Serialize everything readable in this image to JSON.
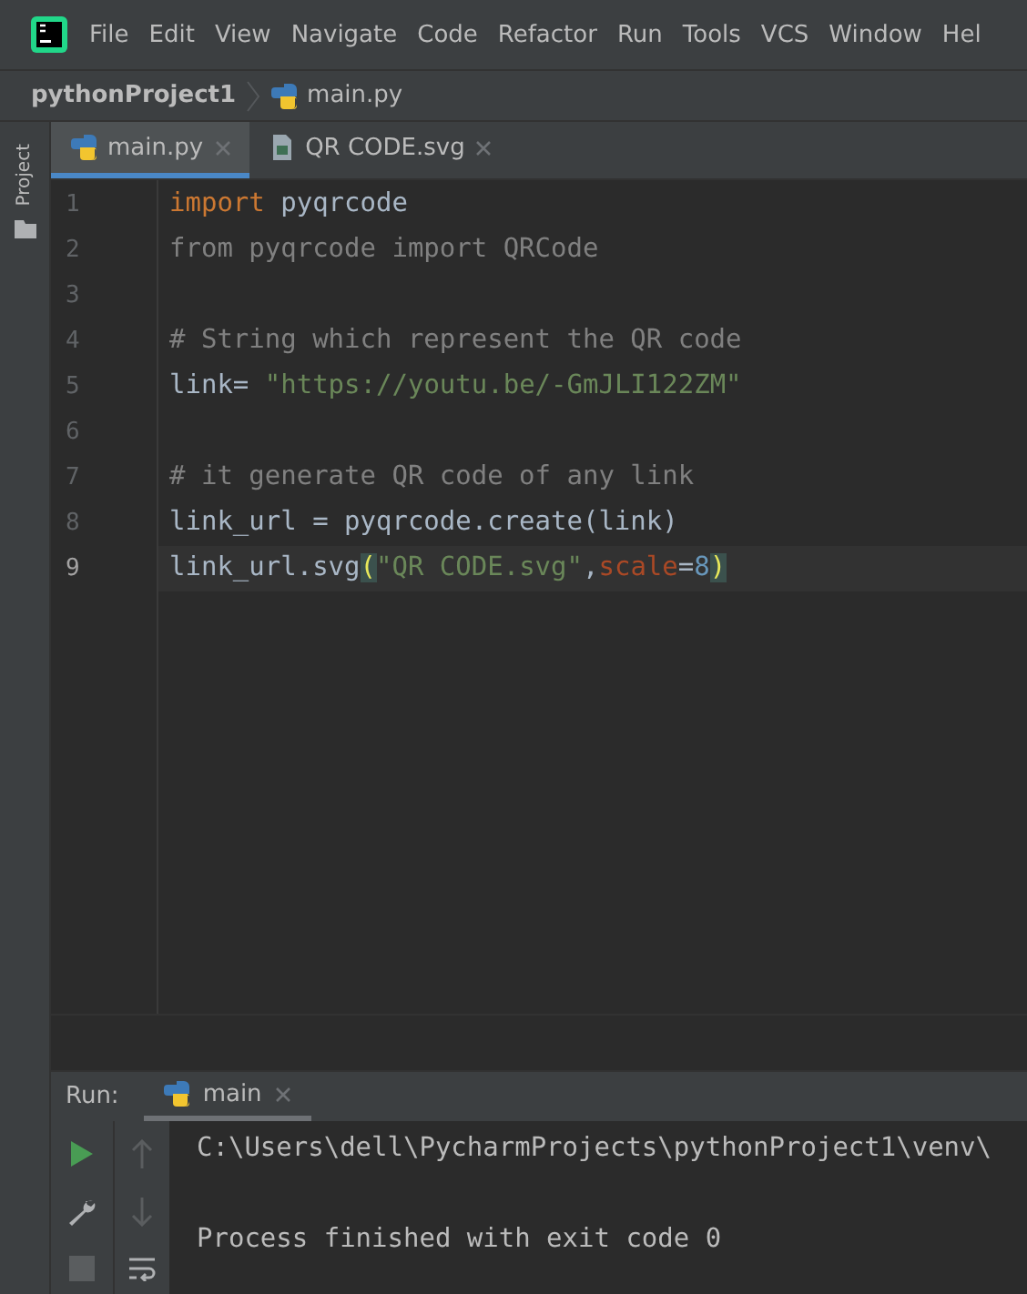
{
  "menu": [
    "File",
    "Edit",
    "View",
    "Navigate",
    "Code",
    "Refactor",
    "Run",
    "Tools",
    "VCS",
    "Window",
    "Hel"
  ],
  "breadcrumb": {
    "project": "pythonProject1",
    "file": "main.py"
  },
  "sidebar": {
    "label": "Project"
  },
  "tabs": [
    {
      "label": "main.py",
      "kind": "python",
      "selected": true
    },
    {
      "label": "QR CODE.svg",
      "kind": "svg",
      "selected": false
    }
  ],
  "editor": {
    "lines": [
      {
        "number": "1",
        "current": false,
        "tokens": [
          {
            "kind": "keyword",
            "text": "import"
          },
          {
            "kind": "plain",
            "text": " pyqrcode"
          }
        ]
      },
      {
        "number": "2",
        "current": false,
        "tokens": [
          {
            "kind": "unused",
            "text": "from pyqrcode import QRCode"
          }
        ]
      },
      {
        "number": "3",
        "current": false
      },
      {
        "number": "4",
        "current": false,
        "tokens": [
          {
            "kind": "comment",
            "text": "# String which represent the QR code"
          }
        ]
      },
      {
        "number": "5",
        "current": false,
        "tokens": [
          {
            "kind": "plain",
            "text": "link= "
          },
          {
            "kind": "string",
            "text": "\"https://youtu.be/-GmJLI122ZM\""
          }
        ]
      },
      {
        "number": "6",
        "current": false
      },
      {
        "number": "7",
        "current": false,
        "tokens": [
          {
            "kind": "comment",
            "text": "# it generate QR code of any link"
          }
        ]
      },
      {
        "number": "8",
        "current": false,
        "tokens": [
          {
            "kind": "plain",
            "text": "link_url = pyqrcode.create(link)"
          }
        ]
      },
      {
        "number": "9",
        "current": true,
        "tokens": [
          {
            "kind": "plain",
            "text": "link_url.svg"
          },
          {
            "kind": "paren",
            "text": "("
          },
          {
            "kind": "string",
            "text": "\"QR CODE.svg\""
          },
          {
            "kind": "plain",
            "text": ","
          },
          {
            "kind": "param",
            "text": "scale"
          },
          {
            "kind": "plain",
            "text": "="
          },
          {
            "kind": "number",
            "text": "8"
          },
          {
            "kind": "paren",
            "text": ")"
          }
        ]
      }
    ]
  },
  "run": {
    "label": "Run:",
    "tab": "main",
    "console": [
      "C:\\Users\\dell\\PycharmProjects\\pythonProject1\\venv\\",
      "Process finished with exit code 0"
    ]
  }
}
